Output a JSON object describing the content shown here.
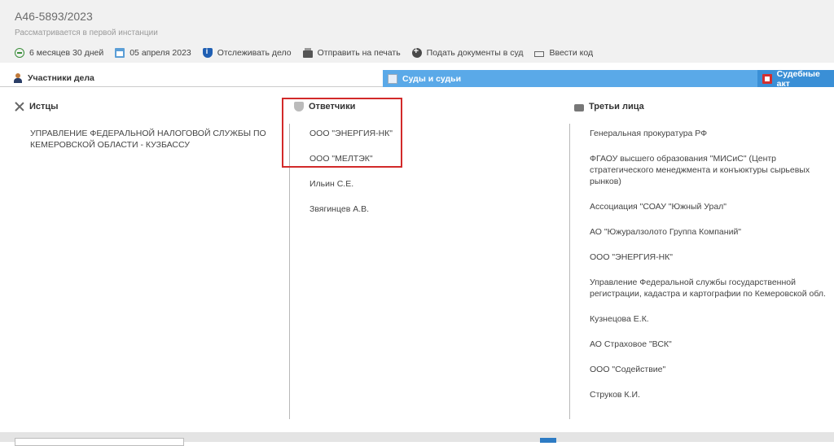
{
  "case": {
    "number": "А46-5893/2023",
    "status": "Рассматривается в первой инстанции"
  },
  "toolbar": {
    "duration": "6 месяцев 30 дней",
    "date": "05 апреля 2023",
    "track": "Отслеживать дело",
    "print": "Отправить на печать",
    "submit": "Подать документы в суд",
    "code": "Ввести код"
  },
  "tabs": {
    "participants": "Участники дела",
    "courts": "Суды и судьи",
    "acts": "Судебные акт"
  },
  "plaintiffs": {
    "title": "Истцы",
    "items": [
      "УПРАВЛЕНИЕ ФЕДЕРАЛЬНОЙ НАЛОГОВОЙ СЛУЖБЫ ПО КЕМЕРОВСКОЙ ОБЛАСТИ - КУЗБАССУ"
    ]
  },
  "defendants": {
    "title": "Ответчики",
    "items": [
      "ООО \"ЭНЕРГИЯ-НК\"",
      "ООО \"МЕЛТЭК\"",
      "Ильин С.Е.",
      "Звягинцев А.В."
    ]
  },
  "third_parties": {
    "title": "Третьи лица",
    "items": [
      "Генеральная прокуратура РФ",
      "ФГАОУ высшего образования \"МИСиС\" (Центр стратегического менеджмента и конъюктуры сырьевых рынков)",
      "Ассоциация \"СОАУ \"Южный Урал\"",
      "АО \"Южуралзолото Группа Компаний\"",
      "ООО \"ЭНЕРГИЯ-НК\"",
      "Управление Федеральной службы государственной регистрации, кадастра и картографии по Кемеровской обл.",
      "Кузнецова Е.К.",
      "АО Страховое \"ВСК\"",
      "ООО \"Содействие\"",
      "Струков К.И."
    ]
  },
  "icons": {
    "duration": "clock-circle-icon",
    "date": "calendar-icon",
    "track": "shield-info-icon",
    "print": "printer-icon",
    "submit": "plus-circle-icon",
    "code": "keyboard-icon",
    "participants": "person-icon",
    "courts": "courthouse-icon",
    "acts": "pdf-icon",
    "plaintiffs": "crossed-swords-icon",
    "defendants": "badge-icon",
    "third_parties": "people-icon"
  },
  "colors": {
    "tab_courts": "#5aa9e8",
    "tab_acts": "#3a8fd6",
    "highlight": "#d22a2a"
  }
}
